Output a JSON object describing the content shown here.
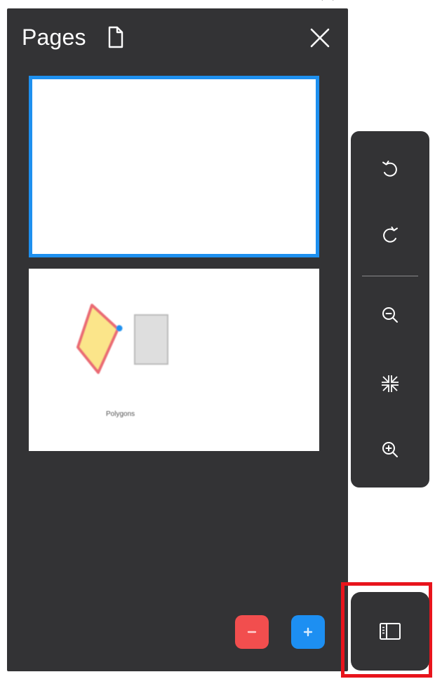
{
  "pages_panel": {
    "title": "Pages",
    "icons": {
      "title_icon": "document-icon",
      "close": "close-icon"
    },
    "pages": [
      {
        "selected": true,
        "caption": ""
      },
      {
        "selected": false,
        "caption": "Polygons"
      }
    ],
    "actions": {
      "remove_icon": "minus-icon",
      "add_icon": "plus-icon",
      "remove_color": "#f24e4e",
      "add_color": "#1d8ff2"
    }
  },
  "toolbar": {
    "tools": [
      {
        "name": "undo",
        "icon": "undo-icon"
      },
      {
        "name": "redo",
        "icon": "redo-icon"
      },
      {
        "name": "zoom-out",
        "icon": "zoom-out-icon"
      },
      {
        "name": "fit-to-screen",
        "icon": "collapse-arrows-icon"
      },
      {
        "name": "zoom-in",
        "icon": "zoom-in-icon"
      }
    ]
  },
  "panel_toggle": {
    "icon": "sidebar-panel-icon",
    "highlight_color": "#e8141c"
  },
  "colors": {
    "panel_bg": "#333335",
    "selection_blue": "#1e90ef",
    "icon_color": "#ffffff"
  }
}
